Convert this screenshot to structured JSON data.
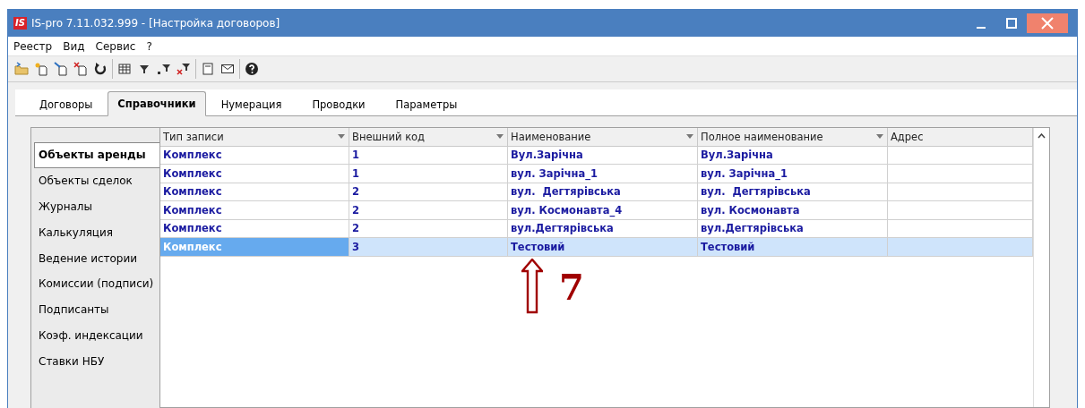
{
  "window": {
    "title": "IS-pro 7.11.032.999 - [Настройка договоров]",
    "logo": "IS"
  },
  "menu": [
    "Реестр",
    "Вид",
    "Сервис",
    "?"
  ],
  "toolbar": [
    {
      "kind": "folder"
    },
    {
      "kind": "new"
    },
    {
      "kind": "edit"
    },
    {
      "kind": "delete"
    },
    {
      "kind": "refresh"
    },
    {
      "kind": "sep"
    },
    {
      "kind": "table"
    },
    {
      "kind": "filter"
    },
    {
      "kind": "filteradd"
    },
    {
      "kind": "filterclear"
    },
    {
      "kind": "sep"
    },
    {
      "kind": "form"
    },
    {
      "kind": "mail"
    },
    {
      "kind": "sep"
    },
    {
      "kind": "help"
    }
  ],
  "tabs": [
    {
      "label": "Договоры",
      "selected": false
    },
    {
      "label": "Справочники",
      "selected": true
    },
    {
      "label": "Нумерация",
      "selected": false
    },
    {
      "label": "Проводки",
      "selected": false
    },
    {
      "label": "Параметры",
      "selected": false
    }
  ],
  "sidebar": {
    "items": [
      {
        "label": "Объекты аренды",
        "selected": true
      },
      {
        "label": "Объекты сделок",
        "selected": false
      },
      {
        "label": "Журналы",
        "selected": false
      },
      {
        "label": "Калькуляция",
        "selected": false
      },
      {
        "label": "Ведение истории",
        "selected": false
      },
      {
        "label": "Комиссии (подписи)",
        "selected": false
      },
      {
        "label": "Подписанты",
        "selected": false
      },
      {
        "label": "Коэф. индексации",
        "selected": false
      },
      {
        "label": "Ставки НБУ",
        "selected": false
      }
    ]
  },
  "table": {
    "columns": [
      {
        "label": "Тип записи",
        "filter": true
      },
      {
        "label": "Внешний код",
        "filter": true
      },
      {
        "label": "Наименование",
        "filter": true
      },
      {
        "label": "Полное наименование",
        "filter": true
      },
      {
        "label": "Адрес",
        "filter": false
      }
    ],
    "rows": [
      {
        "cells": [
          "Комплекс",
          "1",
          "Вул.Зарічна",
          "Вул.Зарічна",
          ""
        ],
        "selected": false
      },
      {
        "cells": [
          "Комплекс",
          "1",
          "вул. Зарічна_1",
          "вул. Зарічна_1",
          ""
        ],
        "selected": false
      },
      {
        "cells": [
          "Комплекс",
          "2",
          "вул.  Дегтярівська",
          "вул.  Дегтярівська",
          ""
        ],
        "selected": false
      },
      {
        "cells": [
          "Комплекс",
          "2",
          "вул. Космонавта_4",
          "вул. Космонавта",
          ""
        ],
        "selected": false
      },
      {
        "cells": [
          "Комплекс",
          "2",
          "вул.Дегтярівська",
          "вул.Дегтярівська",
          ""
        ],
        "selected": false
      },
      {
        "cells": [
          "Комплекс",
          "3",
          "Тестовий",
          "Тестовий",
          ""
        ],
        "selected": true
      }
    ]
  },
  "annotation": {
    "label": "7"
  }
}
